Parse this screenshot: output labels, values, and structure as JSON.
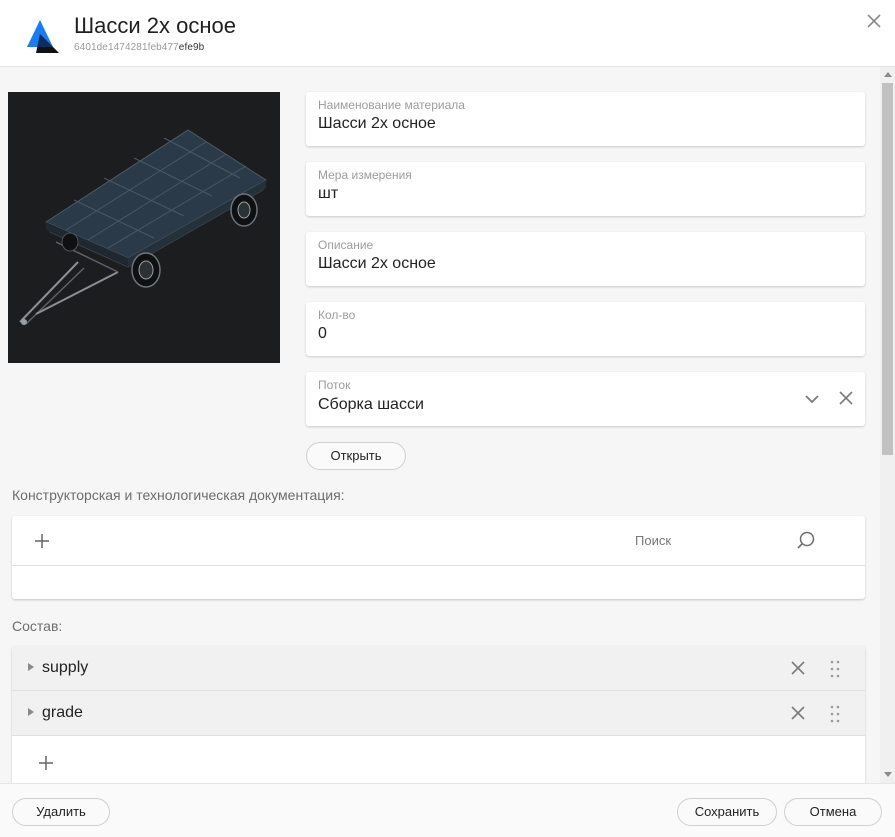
{
  "header": {
    "title": "Шасси 2х осное",
    "id_prefix": "6401de1474281feb477",
    "id_suffix": "efe9b"
  },
  "fields": {
    "material_name": {
      "label": "Наименование материала",
      "value": "Шасси 2х осное"
    },
    "unit": {
      "label": "Мера измерения",
      "value": "шт"
    },
    "description": {
      "label": "Описание",
      "value": "Шасси 2х осное"
    },
    "quantity": {
      "label": "Кол-во",
      "value": "0"
    },
    "flow": {
      "label": "Поток",
      "value": "Сборка шасси"
    }
  },
  "open_button": "Открыть",
  "docs": {
    "label": "Конструкторская и технологическая документация:",
    "search_placeholder": "Поиск"
  },
  "composition": {
    "label": "Состав:",
    "items": [
      {
        "label": "supply"
      },
      {
        "label": "grade"
      }
    ]
  },
  "footer": {
    "delete_label": "Удалить",
    "save_label": "Сохранить",
    "cancel_label": "Отмена"
  },
  "colors": {
    "logo_blue": "#1a7cf5",
    "logo_dark": "#111111",
    "preview_bg": "#1b1d1e"
  },
  "icons": [
    "logo-icon",
    "close-icon",
    "chevron-down-icon",
    "clear-icon",
    "plus-icon",
    "search-icon",
    "expand-arrow-icon",
    "remove-icon",
    "drag-handle-icon"
  ]
}
